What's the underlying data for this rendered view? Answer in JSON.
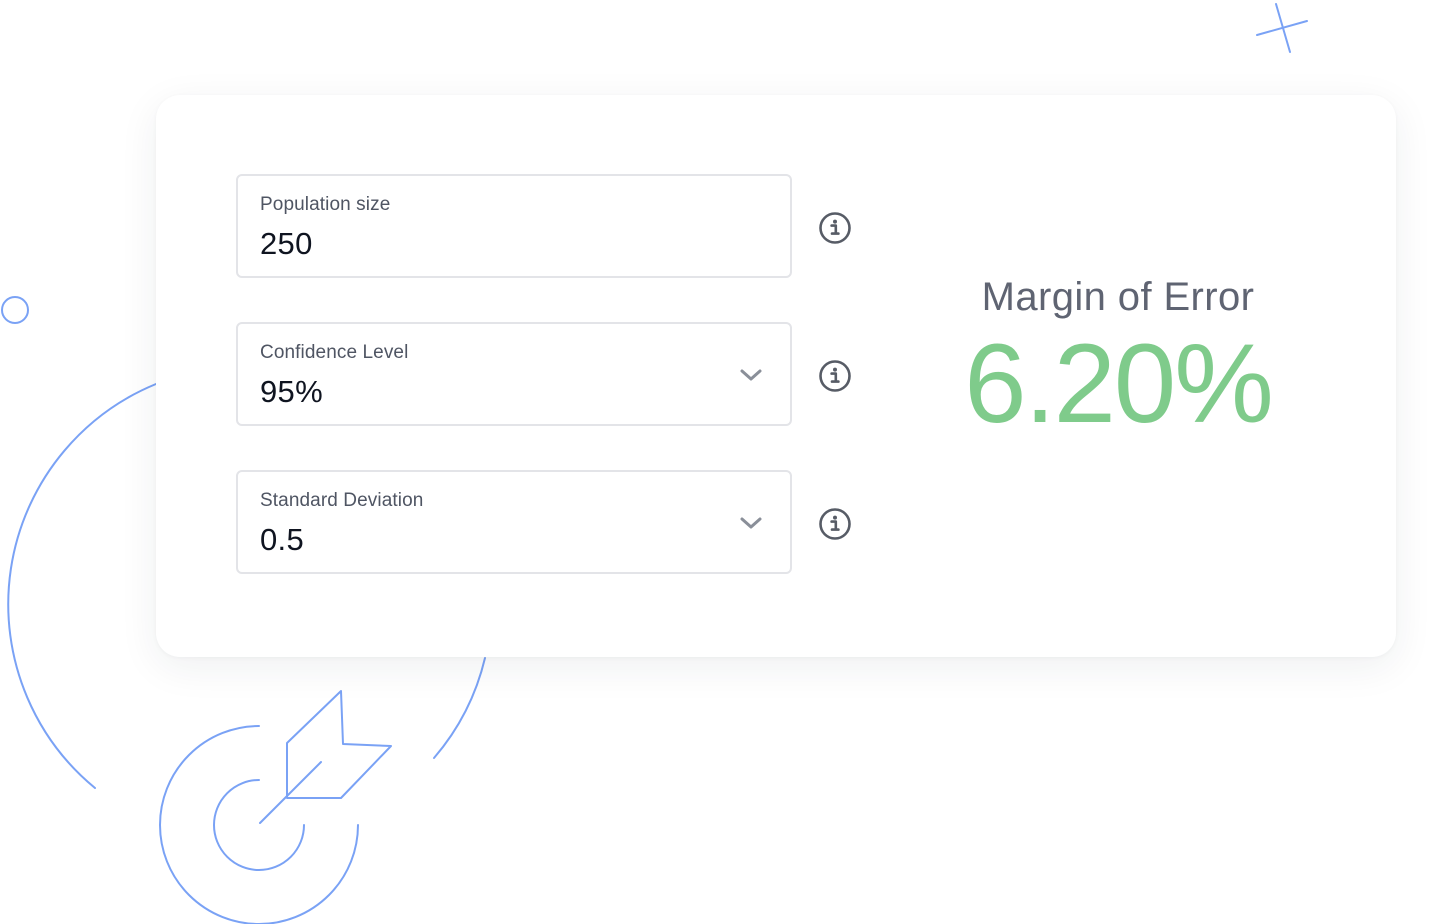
{
  "calculator": {
    "population": {
      "label": "Population size",
      "value": "250",
      "info_icon": "info-icon"
    },
    "confidence": {
      "label": "Confidence Level",
      "value": "95%",
      "dropdown_icon": "chevron-down-icon",
      "info_icon": "info-icon"
    },
    "deviation": {
      "label": "Standard Deviation",
      "value": "0.5",
      "dropdown_icon": "chevron-down-icon",
      "info_icon": "info-icon"
    }
  },
  "result": {
    "label": "Margin of Error",
    "value": "6.20%"
  },
  "colors": {
    "accent_green": "#7fcb8b",
    "decor_blue": "#7aa2f5",
    "text_dark": "#0f1420",
    "text_muted": "#5f6472",
    "border": "#e3e4e8"
  },
  "decorations": [
    "plus-sparkle",
    "small-circle",
    "large-arc",
    "target-with-arrow-icon"
  ]
}
